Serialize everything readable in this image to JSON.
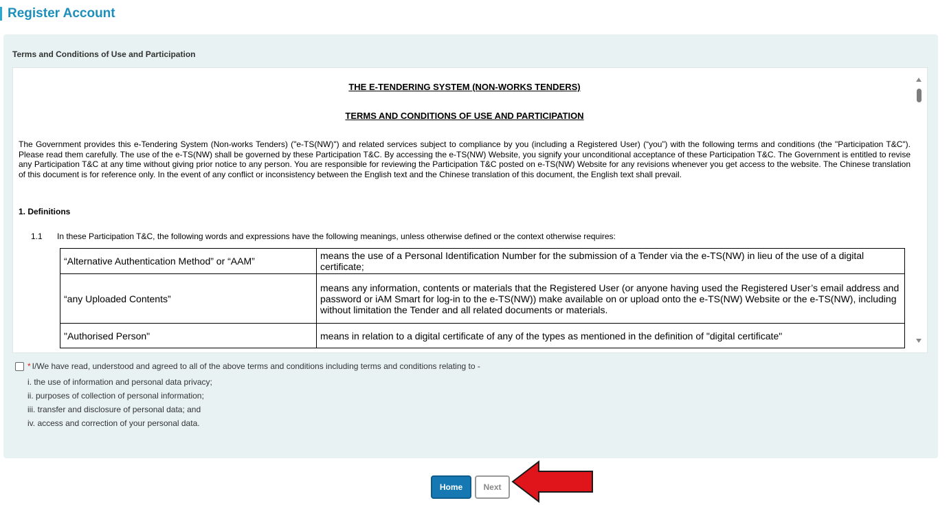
{
  "page": {
    "title": "Register Account"
  },
  "panel": {
    "heading": "Terms and Conditions of Use and Participation"
  },
  "terms": {
    "doc_title": "THE E-TENDERING SYSTEM (NON-WORKS TENDERS)",
    "doc_subtitle": "TERMS AND CONDITIONS OF USE AND PARTICIPATION",
    "intro": "The Government provides this e-Tendering System (Non-works Tenders) (\"e-TS(NW)\") and related services subject to compliance by you (including a Registered User) (“you”) with the following terms and conditions (the \"Participation T&C\"). Please read them carefully. The use of the e-TS(NW) shall be governed by these Participation T&C. By accessing the e-TS(NW) Website, you signify your unconditional acceptance of these Participation T&C. The Government is entitled to revise any Participation T&C at any time without giving prior notice to any person. You are responsible for reviewing the Participation T&C posted on e-TS(NW) Website for any revisions whenever you get access to the website. The Chinese translation of this document is for reference only. In the event of any conflict or inconsistency between the English text and the Chinese translation of this document, the English text shall prevail.",
    "section_heading": "1. Definitions",
    "clause_number": "1.1",
    "clause_text": "In these Participation T&C, the following words and expressions have the following meanings, unless otherwise defined or the context otherwise requires:",
    "definitions": [
      {
        "term": "“Alternative Authentication Method” or “AAM”",
        "meaning": "means the use of a Personal Identification Number for the submission of a Tender via the e-TS(NW) in lieu of the use of a digital certificate;"
      },
      {
        "term": "“any Uploaded Contents”",
        "meaning": "means any information, contents or materials that the Registered User (or anyone having used the Registered User’s email address and password or iAM Smart for log-in to the e-TS(NW)) make available on or upload onto the e-TS(NW) Website or the e-TS(NW), including without limitation the Tender and all related documents or materials."
      },
      {
        "term": "\"Authorised Person\"",
        "meaning": "means in relation to a digital certificate of any of the types as mentioned in the definition of \"digital certificate\""
      }
    ]
  },
  "agreement": {
    "asterisk": "*",
    "label": "I/We have read, understood and agreed to all of the above terms and conditions including terms and conditions relating to -",
    "items": [
      "i. the use of information and personal data privacy;",
      "ii. purposes of collection of personal information;",
      "iii. transfer and disclosure of personal data; and",
      "iv. access and correction of your personal data."
    ]
  },
  "buttons": {
    "home": "Home",
    "next": "Next"
  },
  "colors": {
    "title": "#1c8fbd",
    "home_button": "#1578b3",
    "panel_bg": "#e8f2f2",
    "arrow": "#e0141b"
  }
}
